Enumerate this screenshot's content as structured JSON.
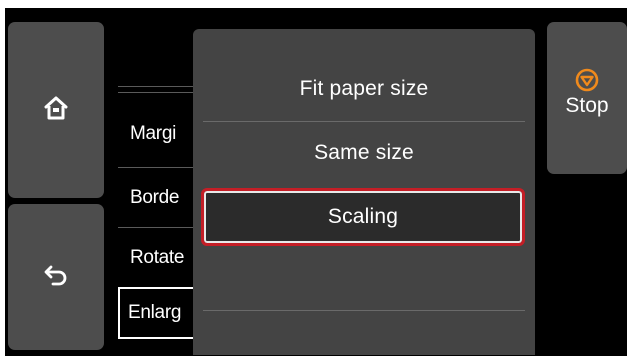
{
  "left_buttons": {
    "home_icon": "home-icon",
    "back_icon": "back-arrow-icon"
  },
  "behind_list": {
    "items": [
      "Margi",
      "Borde",
      "Rotate",
      "Enlarg"
    ]
  },
  "popup_menu": {
    "items": [
      "Fit paper size",
      "Same size",
      "Scaling"
    ],
    "selected_index": 2
  },
  "stop_button": {
    "label": "Stop",
    "icon": "stop-icon",
    "icon_color": "#f08a1c"
  },
  "colors": {
    "background": "#000000",
    "panel_button": "#4d4d4d",
    "popup": "#444444",
    "highlight_border": "#c41e26"
  }
}
